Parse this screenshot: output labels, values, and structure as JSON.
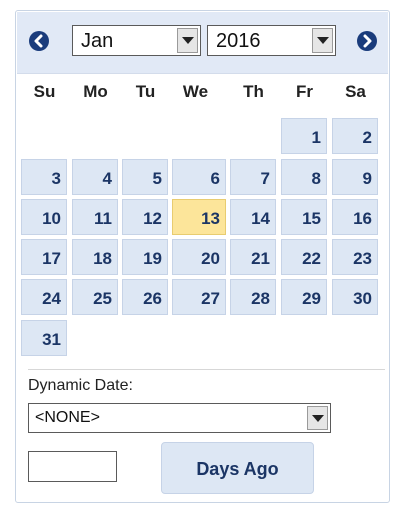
{
  "calendar": {
    "month": "Jan",
    "year": "2016",
    "weekdays": [
      "Su",
      "Mo",
      "Tu",
      "We",
      "Th",
      "Fr",
      "Sa"
    ],
    "first_weekday_index": 5,
    "days_in_month": 31,
    "selected_day": 13,
    "accent_color": "#1a3c7c",
    "day_background": "#dde7f4",
    "today_background": "#fce59a"
  },
  "dynamic": {
    "label": "Dynamic Date:",
    "selected": "<NONE>",
    "days_input_value": "",
    "button_label": "Days Ago"
  },
  "icons": {
    "prev": "chevron-left-circle-icon",
    "next": "chevron-right-circle-icon",
    "dropdown": "caret-down-icon"
  }
}
